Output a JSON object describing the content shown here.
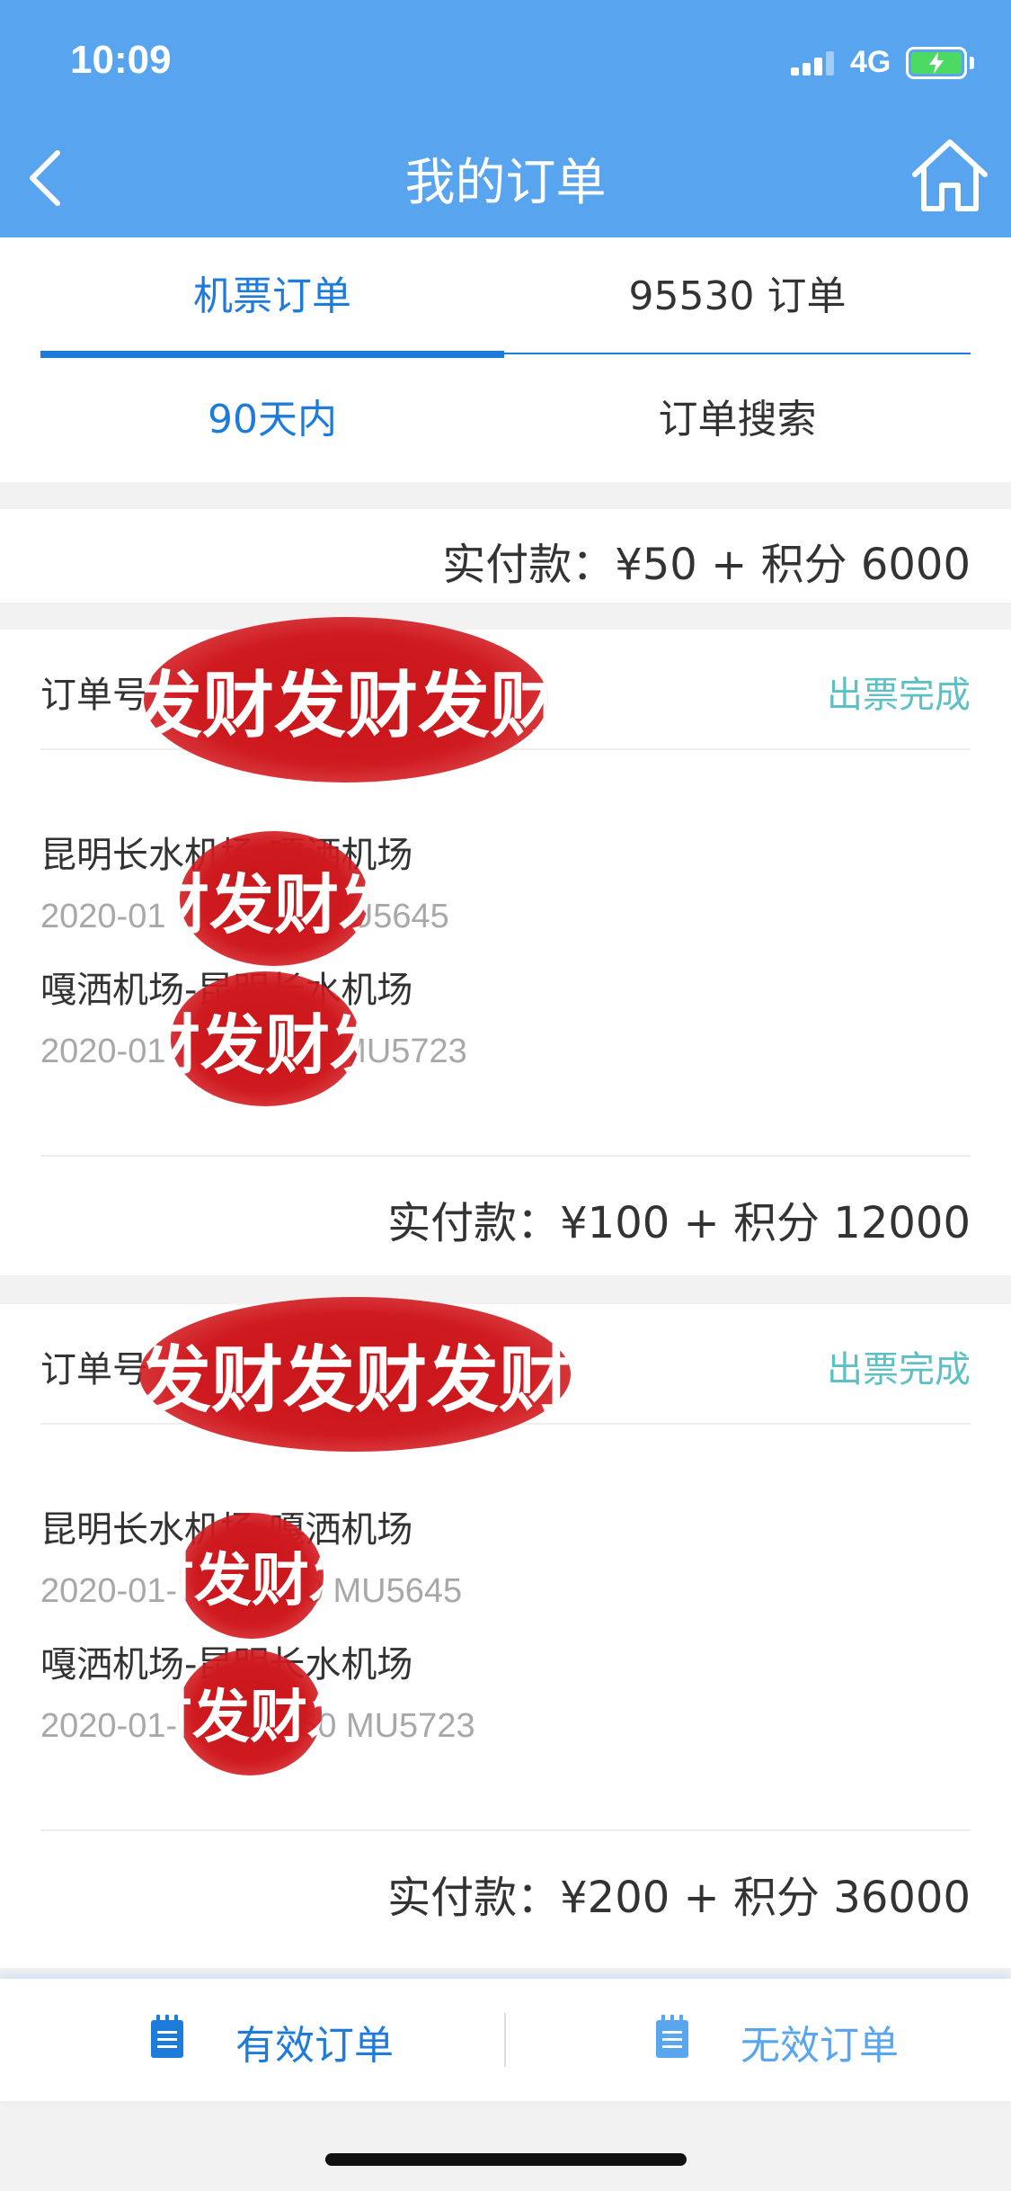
{
  "status_bar": {
    "time": "10:09",
    "network": "4G"
  },
  "nav": {
    "title": "我的订单"
  },
  "tabs": [
    {
      "label": "机票订单",
      "active": true
    },
    {
      "label": "95530 订单",
      "active": false
    }
  ],
  "filters": [
    {
      "label": "90天内",
      "active": true
    },
    {
      "label": "订单搜索",
      "active": false
    }
  ],
  "orders": [
    {
      "payment": "实付款：¥50 + 积分 6000"
    },
    {
      "order_label": "订单号",
      "status": "出票完成",
      "segments": [
        {
          "route": "昆明长水机场-嘎洒机场",
          "detail_start": "2020-01",
          "detail_end": "0 MU5645"
        },
        {
          "route": "嘎洒机场-昆明长水机场",
          "detail_start": "2020-01",
          "detail_end": "0 MU5723"
        }
      ],
      "payment": "实付款：¥100 + 积分 12000"
    },
    {
      "order_label": "订单号",
      "status": "出票完成",
      "segments": [
        {
          "route": "昆明长水机场-嘎洒机场",
          "detail_start": "2020-01-",
          "detail_end": ":40 MU5645"
        },
        {
          "route": "嘎洒机场-昆明长水机场",
          "detail_start": "2020-01-",
          "detail_end": "50 MU5723"
        }
      ],
      "payment": "实付款：¥200 + 积分 36000"
    }
  ],
  "watermark_text": "发财发财发财",
  "bottom_tabs": [
    {
      "label": "有效订单",
      "icon": "document-list-icon",
      "active": true
    },
    {
      "label": "无效订单",
      "icon": "document-list-icon",
      "active": false
    }
  ],
  "colors": {
    "header_bg": "#58a4ee",
    "accent": "#1d7bd9",
    "status_teal": "#5cc0c4",
    "watermark_red": "#cf1a1f"
  }
}
